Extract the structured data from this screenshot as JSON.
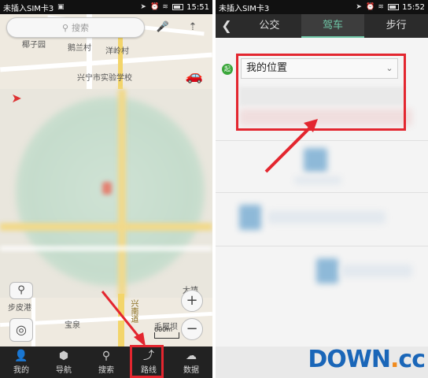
{
  "left": {
    "status": {
      "carrier": "未插入SIM卡3",
      "time": "15:51"
    },
    "search": {
      "placeholder": "搜索"
    },
    "map_labels": [
      "椰子园",
      "鹅兰村",
      "洋岭村",
      "兴宁市实验学校",
      "宝泉",
      "大禧",
      "毛屋坝",
      "兴南道",
      "步皮港"
    ],
    "scale": "600m",
    "nav": [
      {
        "label": "我的",
        "icon": "user-icon"
      },
      {
        "label": "导航",
        "icon": "navigation-icon"
      },
      {
        "label": "搜索",
        "icon": "search-icon"
      },
      {
        "label": "路线",
        "icon": "route-icon"
      },
      {
        "label": "数据",
        "icon": "cloud-icon"
      }
    ]
  },
  "right": {
    "status": {
      "carrier": "未插入SIM卡3",
      "time": "15:52"
    },
    "tabs": [
      "公交",
      "驾车",
      "步行"
    ],
    "active_tab": "驾车",
    "start_badge": "起",
    "origin_value": "我的位置"
  },
  "watermark": {
    "brand": "DOWN",
    "dot": ".",
    "tld": "cc"
  },
  "colors": {
    "highlight": "#e3262f",
    "active_tab": "#6fc7a7",
    "watermark": "#1a66b8"
  }
}
